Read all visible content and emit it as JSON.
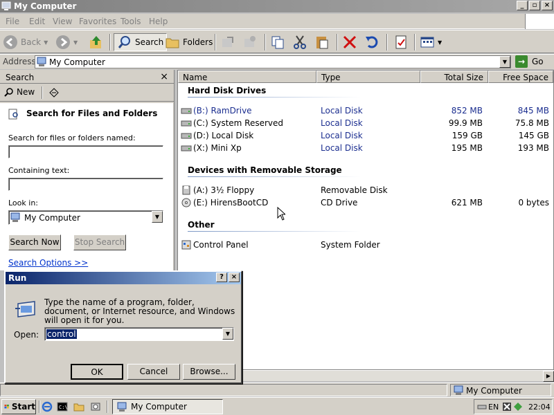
{
  "window": {
    "title": "My Computer"
  },
  "menu": [
    "File",
    "Edit",
    "View",
    "Favorites",
    "Tools",
    "Help"
  ],
  "toolbar": {
    "back": "Back",
    "search": "Search",
    "folders": "Folders"
  },
  "address": {
    "label": "Address",
    "value": "My Computer",
    "go": "Go"
  },
  "search_pane": {
    "title": "Search",
    "new_label": "New",
    "heading": "Search for Files and Folders",
    "name_label": "Search for files or folders named:",
    "name_value": "",
    "text_label": "Containing text:",
    "text_value": "",
    "lookin_label": "Look in:",
    "lookin_value": "My Computer",
    "search_now": "Search Now",
    "stop_search": "Stop Search",
    "options_link": "Search Options >>"
  },
  "columns": [
    "Name",
    "Type",
    "Total Size",
    "Free Space"
  ],
  "groups": {
    "hdd": "Hard Disk Drives",
    "removable": "Devices with Removable Storage",
    "other": "Other"
  },
  "drives": [
    {
      "name": "(B:) RamDrive",
      "type": "Local Disk",
      "total": "852 MB",
      "free": "845 MB"
    },
    {
      "name": "(C:) System Reserved",
      "type": "Local Disk",
      "total": "99.9 MB",
      "free": "75.8 MB"
    },
    {
      "name": "(D:) Local Disk",
      "type": "Local Disk",
      "total": "159 GB",
      "free": "145 GB"
    },
    {
      "name": "(X:) Mini Xp",
      "type": "Local Disk",
      "total": "195 MB",
      "free": "193 MB"
    }
  ],
  "removable": [
    {
      "name": "(A:) 3½ Floppy",
      "type": "Removable Disk",
      "total": "",
      "free": ""
    },
    {
      "name": "(E:) HirensBootCD",
      "type": "CD Drive",
      "total": "621 MB",
      "free": "0 bytes"
    }
  ],
  "other": [
    {
      "name": "Control Panel",
      "type": "System Folder"
    }
  ],
  "status": {
    "location": "My Computer"
  },
  "taskbar": {
    "start": "Start",
    "task": "My Computer",
    "lang": "EN",
    "clock": "22:04"
  },
  "run_dialog": {
    "title": "Run",
    "help": "?",
    "message": "Type the name of a program, folder, document, or Internet resource, and Windows will open it for you.",
    "open_label": "Open:",
    "open_value": "control",
    "ok": "OK",
    "cancel": "Cancel",
    "browse": "Browse..."
  },
  "colors": {
    "selected_text": "#1a2d8f",
    "title_active": "#0a246a",
    "link": "#0033cc"
  }
}
